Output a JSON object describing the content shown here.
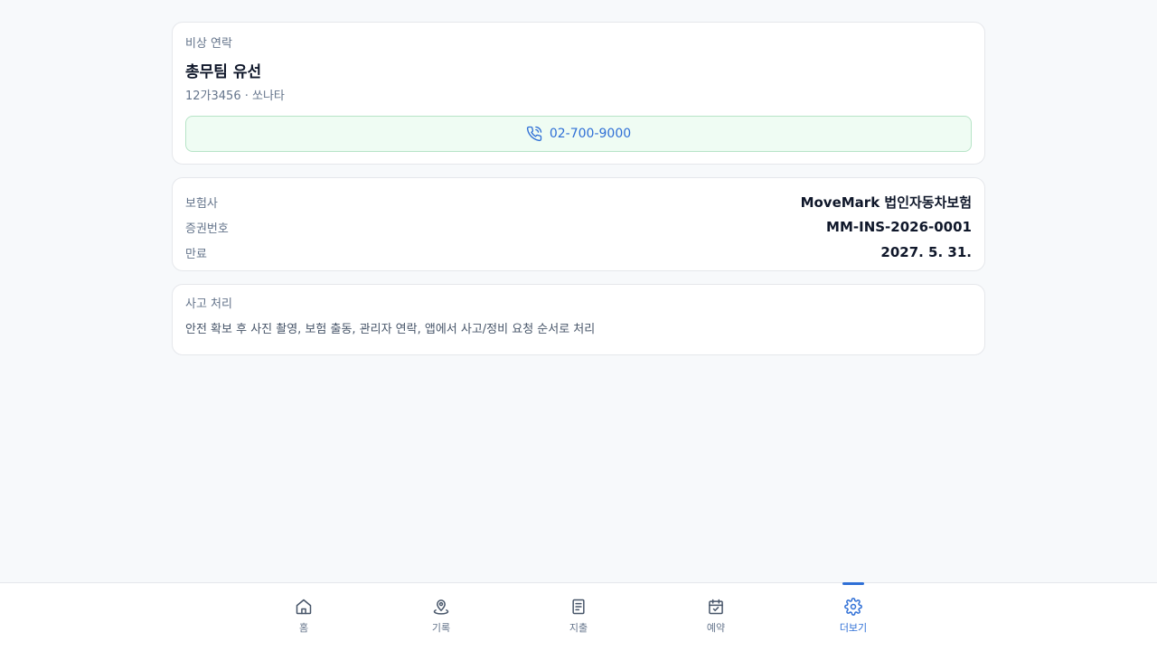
{
  "emergency": {
    "section_label": "비상 연락",
    "title": "총무팀 유선",
    "vehicle": "12가3456 · 쏘나타",
    "phone": "02-700-9000",
    "phone_icon": "phone-icon"
  },
  "insurance": {
    "rows": [
      {
        "label": "보험사",
        "value": "MoveMark 법인자동차보험"
      },
      {
        "label": "증권번호",
        "value": "MM-INS-2026-0001"
      },
      {
        "label": "만료",
        "value": "2027. 5. 31."
      }
    ]
  },
  "accident": {
    "section_label": "사고 처리",
    "description": "안전 확보 후 사진 촬영, 보험 출동, 관리자 연락, 앱에서 사고/정비 요청 순서로 처리"
  },
  "nav": {
    "items": [
      {
        "label": "홈",
        "icon": "home-icon"
      },
      {
        "label": "기록",
        "icon": "map-pin-icon"
      },
      {
        "label": "지출",
        "icon": "receipt-icon"
      },
      {
        "label": "예약",
        "icon": "calendar-check-icon"
      },
      {
        "label": "더보기",
        "icon": "gear-icon",
        "active": true
      }
    ]
  },
  "colors": {
    "accent": "#2f6fd6",
    "call_bg": "#effcf3",
    "call_border": "#b7e4c7",
    "page_bg": "#f7f9fb"
  }
}
